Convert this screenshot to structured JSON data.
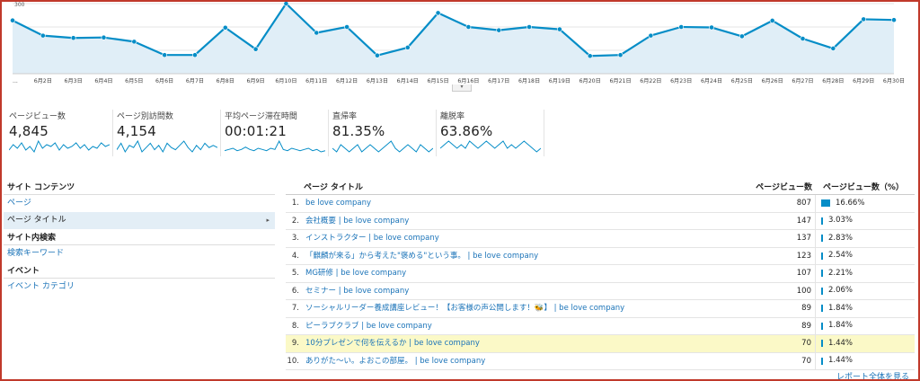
{
  "chart_data": {
    "type": "area",
    "x": [
      "...",
      "6月2日",
      "6月3日",
      "6月4日",
      "6月5日",
      "6月6日",
      "6月7日",
      "6月8日",
      "6月9日",
      "6月10日",
      "6月11日",
      "6月12日",
      "6月13日",
      "6月14日",
      "6月15日",
      "6月16日",
      "6月17日",
      "6月18日",
      "6月19日",
      "6月20日",
      "6月21日",
      "6月22日",
      "6月23日",
      "6月24日",
      "6月25日",
      "6月26日",
      "6月27日",
      "6月28日",
      "6月29日",
      "6月30日"
    ],
    "values": [
      228,
      163,
      153,
      155,
      137,
      80,
      80,
      197,
      105,
      300,
      175,
      200,
      78,
      112,
      260,
      200,
      186,
      200,
      190,
      76,
      80,
      163,
      200,
      198,
      160,
      227,
      150,
      108,
      233,
      230
    ],
    "yticks": [
      "100",
      "200",
      "300"
    ],
    "ylim": [
      0,
      300
    ],
    "line_color": "#058dc7",
    "fill_color": "#e0eef7",
    "grid": true
  },
  "metrics": [
    {
      "label": "ページビュー数",
      "value": "4,845",
      "spark": [
        6,
        9,
        7,
        10,
        6,
        8,
        5,
        11,
        7,
        9,
        8,
        10,
        6,
        9,
        7,
        8,
        10,
        7,
        9,
        6,
        8,
        7,
        10,
        8,
        9
      ]
    },
    {
      "label": "ページ別訪問数",
      "value": "4,154",
      "spark": [
        7,
        10,
        6,
        9,
        8,
        11,
        6,
        8,
        10,
        7,
        9,
        6,
        10,
        8,
        7,
        9,
        11,
        8,
        6,
        9,
        7,
        10,
        8,
        9,
        8
      ]
    },
    {
      "label": "平均ページ滞在時間",
      "value": "00:01:21",
      "spark": [
        4,
        5,
        6,
        4,
        5,
        7,
        5,
        4,
        6,
        5,
        4,
        6,
        5,
        12,
        5,
        4,
        6,
        5,
        4,
        5,
        6,
        4,
        5,
        3,
        4
      ]
    },
    {
      "label": "直帰率",
      "value": "81.35%",
      "spark": [
        9,
        8,
        10,
        9,
        8,
        9,
        10,
        8,
        9,
        10,
        9,
        8,
        9,
        10,
        11,
        9,
        8,
        9,
        10,
        9,
        8,
        10,
        9,
        8,
        9
      ]
    },
    {
      "label": "離脱率",
      "value": "63.86%",
      "spark": [
        8,
        9,
        10,
        9,
        8,
        9,
        8,
        10,
        9,
        8,
        9,
        10,
        9,
        8,
        9,
        10,
        8,
        9,
        8,
        9,
        10,
        9,
        8,
        7,
        8
      ]
    }
  ],
  "nav": {
    "site_content_header": "サイト コンテンツ",
    "page_item": "ページ",
    "page_title_item": "ページ タイトル",
    "site_search_header": "サイト内検索",
    "search_keyword_item": "検索キーワード",
    "events_header": "イベント",
    "event_category_item": "イベント カテゴリ",
    "arrow": "▸"
  },
  "table": {
    "col_title": "ページ タイトル",
    "col_pv": "ページビュー数",
    "col_pct": "ページビュー数（%）",
    "rows": [
      {
        "idx": "1.",
        "title": "be love company",
        "pv": "807",
        "pct": "16.66%",
        "frac": 0.1666
      },
      {
        "idx": "2.",
        "title": "会社概要 | be love company",
        "pv": "147",
        "pct": "3.03%",
        "frac": 0.0303
      },
      {
        "idx": "3.",
        "title": "インストラクター | be love company",
        "pv": "137",
        "pct": "2.83%",
        "frac": 0.0283
      },
      {
        "idx": "4.",
        "title": "「麒麟が来る」から考えた\"褒める\"という事。 | be love company",
        "pv": "123",
        "pct": "2.54%",
        "frac": 0.0254
      },
      {
        "idx": "5.",
        "title": "MG研修 | be love company",
        "pv": "107",
        "pct": "2.21%",
        "frac": 0.0221
      },
      {
        "idx": "6.",
        "title": "セミナー | be love company",
        "pv": "100",
        "pct": "2.06%",
        "frac": 0.0206
      },
      {
        "idx": "7.",
        "title": "ソーシャルリーダー養成講座レビュー！【お客様の声公開します！🐝】 | be love company",
        "pv": "89",
        "pct": "1.84%",
        "frac": 0.0184
      },
      {
        "idx": "8.",
        "title": "ピーラブクラブ | be love company",
        "pv": "89",
        "pct": "1.84%",
        "frac": 0.0184
      },
      {
        "idx": "9.",
        "title": "10分プレゼンで何を伝えるか | be love company",
        "pv": "70",
        "pct": "1.44%",
        "frac": 0.0144
      },
      {
        "idx": "10.",
        "title": "ありがた～い。よおこの部屋。 | be love company",
        "pv": "70",
        "pct": "1.44%",
        "frac": 0.0144
      }
    ]
  },
  "report_link": "レポート全体を見る"
}
